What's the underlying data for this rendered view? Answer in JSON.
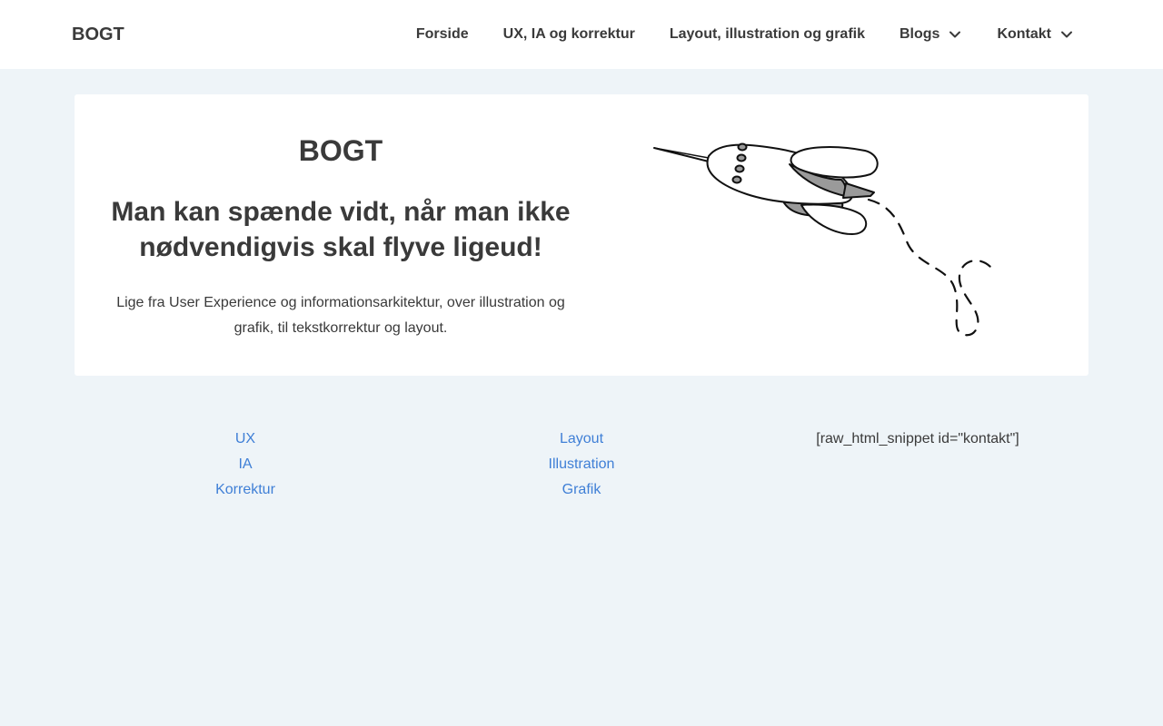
{
  "header": {
    "site_title": "BOGT",
    "nav": [
      {
        "label": "Forside",
        "has_dropdown": false
      },
      {
        "label": "UX, IA og korrektur",
        "has_dropdown": false
      },
      {
        "label": "Layout, illustration og grafik",
        "has_dropdown": false
      },
      {
        "label": "Blogs",
        "has_dropdown": true
      },
      {
        "label": "Kontakt",
        "has_dropdown": true
      }
    ]
  },
  "hero": {
    "title": "BOGT",
    "subtitle": "Man kan spænde vidt, når man ikke nødvendigvis skal flyve ligeud!",
    "text": "Lige fra User Experience og informationsarkitektur, over illustration og grafik, til tekstkorrektur og layout.",
    "illustration": "rocket-illustration"
  },
  "links": {
    "col1": [
      "UX",
      "IA",
      "Korrektur"
    ],
    "col2": [
      "Layout",
      "Illustration",
      "Grafik"
    ],
    "col3_snippet": "[raw_html_snippet id=\"kontakt\"]"
  },
  "colors": {
    "background": "#eef4f8",
    "text": "#3a3a3a",
    "link": "#3f7fd6",
    "card": "#ffffff"
  }
}
